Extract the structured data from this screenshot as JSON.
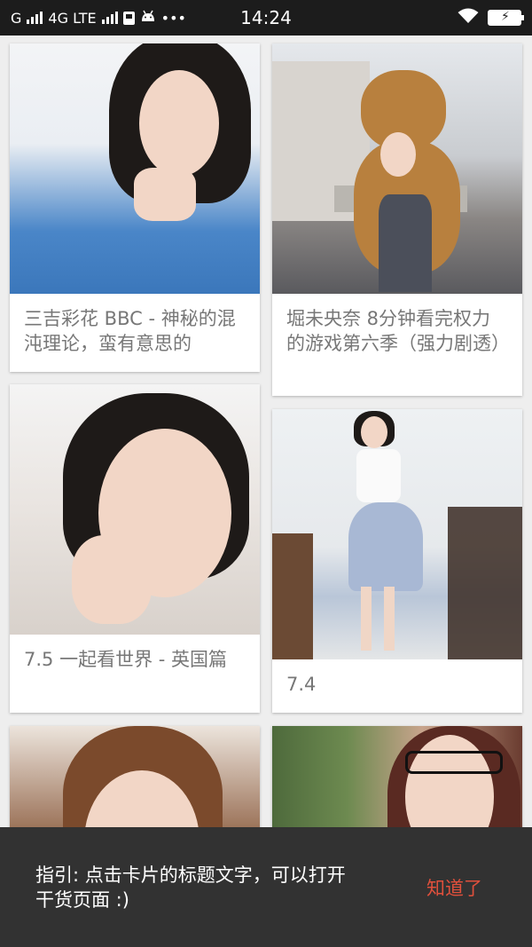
{
  "status_bar": {
    "carrier": "G",
    "network": "4G LTE",
    "time": "14:24",
    "icons": [
      "signal-icon",
      "sim-icon",
      "android-icon",
      "more-dots-icon",
      "wifi-icon",
      "battery-charging-icon"
    ],
    "more": "•••"
  },
  "feed": {
    "cards": [
      {
        "title": "三吉彩花 BBC - 神秘的混沌理论，蛮有意思的"
      },
      {
        "title": "堀未央奈 8分钟看完权力的游戏第六季（强力剧透）"
      },
      {
        "title": "7.5 一起看世界 - 英国篇"
      },
      {
        "title": "7.4"
      },
      {
        "title": ""
      },
      {
        "title": ""
      }
    ]
  },
  "guide": {
    "text": "指引: 点击卡片的标题文字，可以打开干货页面 :)",
    "button": "知道了",
    "button_color": "#e0503c"
  }
}
